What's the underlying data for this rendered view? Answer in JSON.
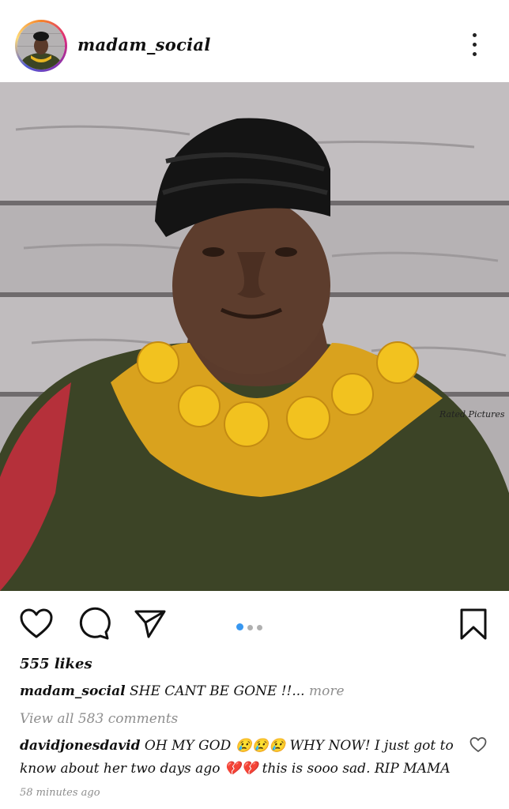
{
  "header": {
    "username": "madam_social",
    "avatar_icon": "profile-avatar",
    "more_icon": "more-vertical-icon"
  },
  "post": {
    "watermark": "Rated Pictures",
    "carousel": {
      "total": 3,
      "active": 1
    },
    "likes": "555 likes",
    "caption": {
      "username": "madam_social",
      "text": "SHE CANT BE GONE !!...",
      "more_label": "more"
    },
    "view_comments": "View all 583 comments",
    "comment": {
      "username": "davidjonesdavid",
      "text": "OH MY GOD 😢😢😢 WHY NOW! I just got to know about her two days ago 💔💔 this is sooo sad. RIP MAMA"
    },
    "timestamp": "58 minutes ago"
  },
  "colors": {
    "accent": "#3897f0",
    "muted": "#8e8e8e",
    "text": "#111111"
  }
}
